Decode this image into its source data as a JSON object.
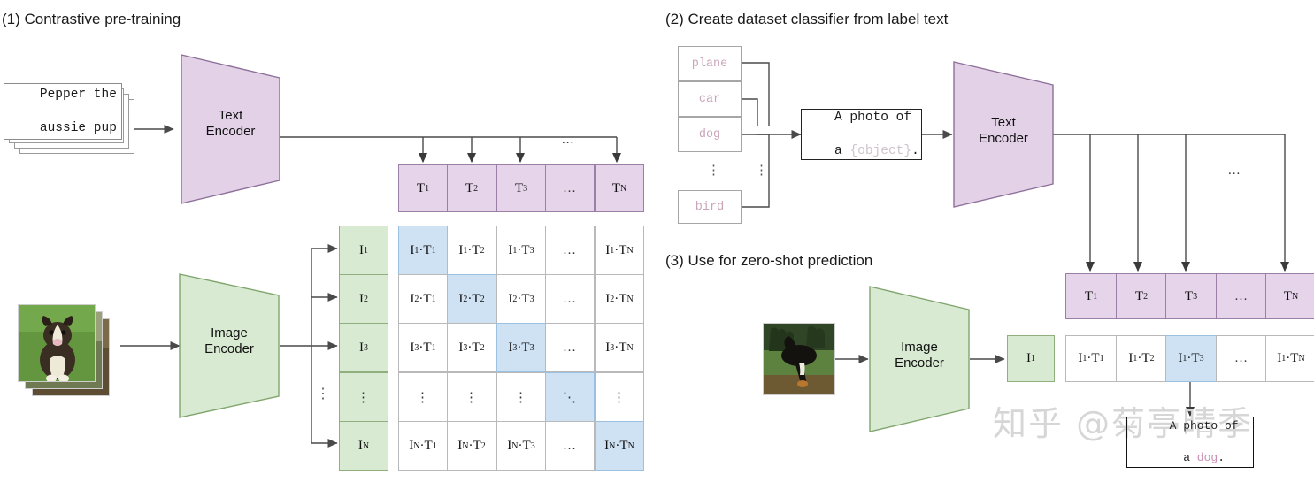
{
  "figure": {
    "type": "diagram",
    "name": "CLIP contrastive pre-training and zero-shot prediction overview",
    "watermark": "知乎 @菊亭晴季"
  },
  "colors": {
    "text_embedding_fill": "#e6d4ea",
    "text_embedding_stroke": "#9b7fa6",
    "image_embedding_fill": "#d9ead3",
    "image_embedding_stroke": "#8fb07e",
    "highlight_fill": "#cfe2f3",
    "highlight_stroke": "#9cc0e0",
    "label_text": "#c9a5bb",
    "cell_stroke": "#b9b9b9"
  },
  "panel1": {
    "title": "(1) Contrastive pre-training",
    "caption_stack": {
      "line1": "Pepper the",
      "line2": "aussie pup"
    },
    "text_encoder": "Text\nEncoder",
    "text_encoder_line1": "Text",
    "text_encoder_line2": "Encoder",
    "image_encoder_line1": "Image",
    "image_encoder_line2": "Encoder",
    "text_embeddings": [
      "T₁",
      "T₂",
      "T₃",
      "…",
      "Tₙ"
    ],
    "text_embeddings_parts": [
      {
        "base": "T",
        "sub": "1"
      },
      {
        "base": "T",
        "sub": "2"
      },
      {
        "base": "T",
        "sub": "3"
      },
      {
        "base": "…",
        "sub": ""
      },
      {
        "base": "T",
        "sub": "N"
      }
    ],
    "image_embeddings_parts": [
      {
        "base": "I",
        "sub": "1"
      },
      {
        "base": "I",
        "sub": "2"
      },
      {
        "base": "I",
        "sub": "3"
      },
      {
        "base": "⋮",
        "sub": ""
      },
      {
        "base": "I",
        "sub": "N"
      }
    ],
    "ellipsis_above_arrows": "...",
    "matrix": {
      "row_labels": [
        "I₁",
        "I₂",
        "I₃",
        "⋮",
        "Iₙ"
      ],
      "col_labels": [
        "T₁",
        "T₂",
        "T₃",
        "…",
        "Tₙ"
      ],
      "rows": [
        [
          "I₁·T₁",
          "I₁·T₂",
          "I₁·T₃",
          "…",
          "I₁·Tₙ"
        ],
        [
          "I₂·T₁",
          "I₂·T₂",
          "I₂·T₃",
          "…",
          "I₂·Tₙ"
        ],
        [
          "I₃·T₁",
          "I₃·T₂",
          "I₃·T₃",
          "…",
          "I₃·Tₙ"
        ],
        [
          "⋮",
          "⋮",
          "⋮",
          "⋱",
          "⋮"
        ],
        [
          "Iₙ·T₁",
          "Iₙ·T₂",
          "Iₙ·T₃",
          "…",
          "Iₙ·Tₙ"
        ]
      ],
      "highlighted_cells": [
        [
          0,
          0
        ],
        [
          1,
          1
        ],
        [
          2,
          2
        ],
        [
          3,
          3
        ],
        [
          4,
          4
        ]
      ]
    }
  },
  "panel2": {
    "title": "(2) Create dataset classifier from label text",
    "labels": [
      "plane",
      "car",
      "dog",
      "bird"
    ],
    "labels_ellipsis": "⋮",
    "prompt_line1": "A photo of",
    "prompt_line2_prefix": "a ",
    "prompt_line2_placeholder": "{object}",
    "prompt_line2_suffix": ".",
    "text_encoder_line1": "Text",
    "text_encoder_line2": "Encoder",
    "ellipsis_above_arrows": "...",
    "text_embeddings_parts": [
      {
        "base": "T",
        "sub": "1"
      },
      {
        "base": "T",
        "sub": "2"
      },
      {
        "base": "T",
        "sub": "3"
      },
      {
        "base": "…",
        "sub": ""
      },
      {
        "base": "T",
        "sub": "N"
      }
    ]
  },
  "panel3": {
    "title": "(3) Use for zero-shot prediction",
    "image_encoder_line1": "Image",
    "image_encoder_line2": "Encoder",
    "image_embedding": {
      "base": "I",
      "sub": "1"
    },
    "scores": [
      "I₁·T₁",
      "I₁·T₂",
      "I₁·T₃",
      "…",
      "I₁·Tₙ"
    ],
    "highlighted_score_index": 2,
    "prediction_line1": "A photo of",
    "prediction_line2_prefix": "a ",
    "prediction_line2_label": "dog",
    "prediction_line2_suffix": "."
  }
}
